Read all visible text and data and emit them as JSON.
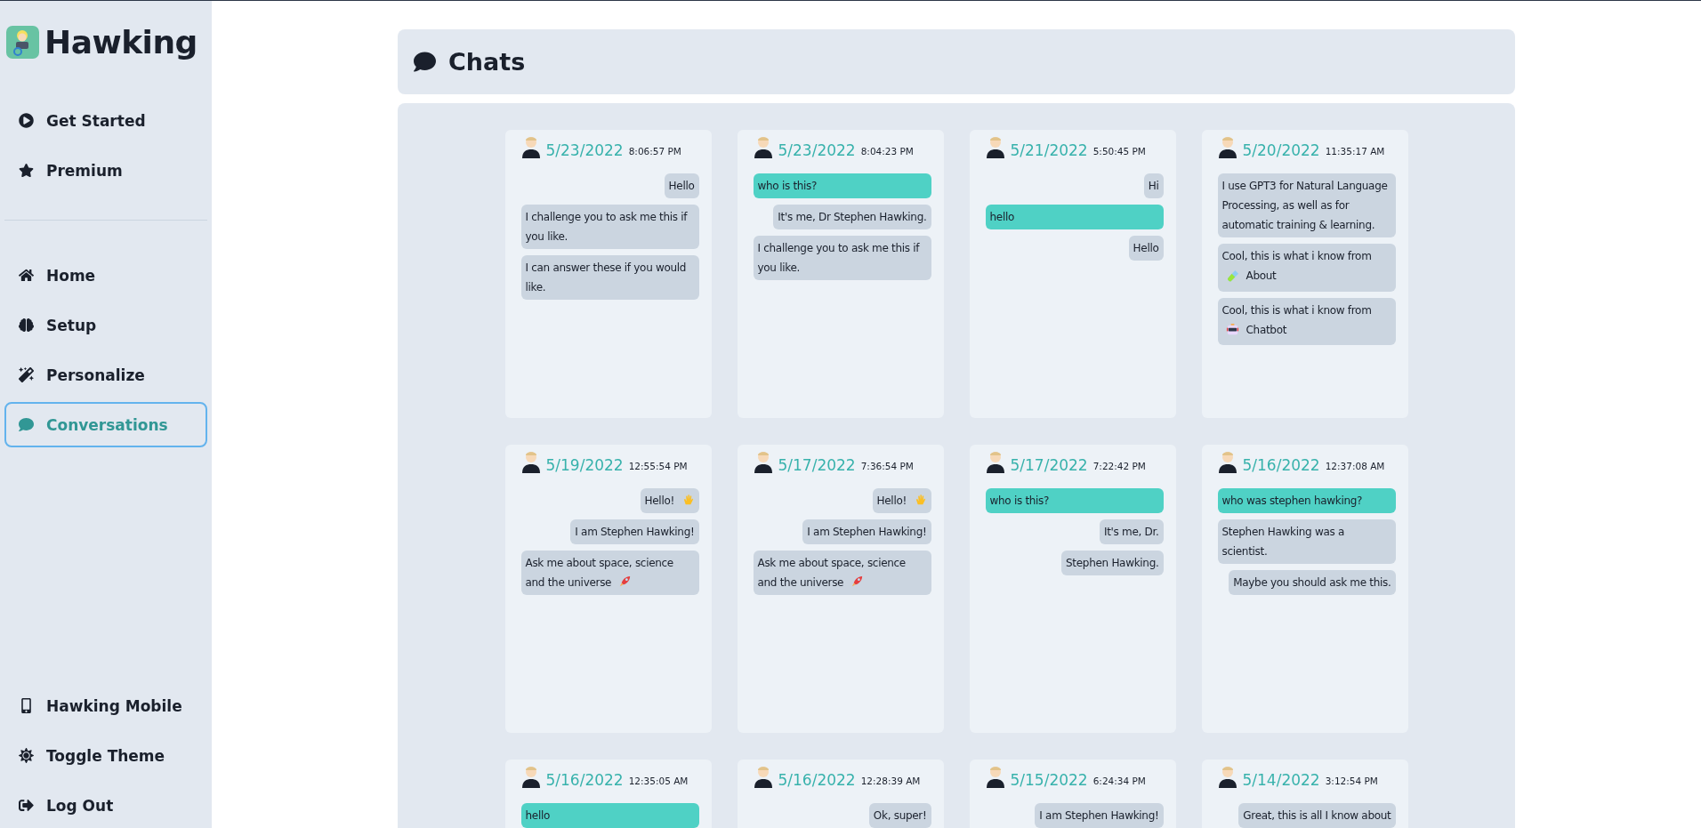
{
  "brand": {
    "name": "Hawking"
  },
  "sidebar": {
    "top_items": [
      {
        "label": "Get Started",
        "selected": false
      },
      {
        "label": "Premium",
        "selected": false
      }
    ],
    "items": [
      {
        "label": "Home",
        "selected": false
      },
      {
        "label": "Setup",
        "selected": false
      },
      {
        "label": "Personalize",
        "selected": false
      },
      {
        "label": "Conversations",
        "selected": true
      }
    ],
    "bottom_items": [
      {
        "label": "Hawking Mobile",
        "selected": false
      },
      {
        "label": "Toggle Theme",
        "selected": false
      },
      {
        "label": "Log Out",
        "selected": false
      }
    ]
  },
  "header": {
    "title": "Chats"
  },
  "chats": [
    {
      "date": "5/23/2022",
      "time": "8:06:57 PM",
      "messages": [
        {
          "kind": "bot",
          "text": "Hello"
        },
        {
          "kind": "bot",
          "text": "I challenge you to ask me this if you like."
        },
        {
          "kind": "bot",
          "text": "I can answer these if you would like."
        }
      ]
    },
    {
      "date": "5/23/2022",
      "time": "8:04:23 PM",
      "messages": [
        {
          "kind": "user",
          "text": "who is this?"
        },
        {
          "kind": "bot",
          "text": "It's me, Dr Stephen Hawking."
        },
        {
          "kind": "bot",
          "text": "I challenge you to ask me this if you like."
        }
      ]
    },
    {
      "date": "5/21/2022",
      "time": "5:50:45 PM",
      "messages": [
        {
          "kind": "bot",
          "text": "Hi"
        },
        {
          "kind": "user",
          "text": "hello"
        },
        {
          "kind": "bot",
          "text": "Hello"
        }
      ]
    },
    {
      "date": "5/20/2022",
      "time": "11:35:17 AM",
      "messages": [
        {
          "kind": "bot",
          "text": "I use GPT3 for Natural Language Processing, as well as for automatic training & learning."
        },
        {
          "kind": "bot",
          "text": "Cool, this is what i know from",
          "emoji": {
            "kind": "test-tube"
          },
          "link": "About"
        },
        {
          "kind": "bot",
          "text": "Cool, this is what i know from",
          "emoji": {
            "kind": "robot"
          },
          "link": "Chatbot"
        }
      ]
    },
    {
      "date": "5/19/2022",
      "time": "12:55:54 PM",
      "messages": [
        {
          "kind": "bot",
          "text": "Hello!",
          "emoji": {
            "kind": "wave"
          }
        },
        {
          "kind": "bot",
          "text": "I am Stephen Hawking!"
        },
        {
          "kind": "bot",
          "text": "Ask me about space, science and the universe",
          "emoji": {
            "kind": "rocket"
          }
        }
      ]
    },
    {
      "date": "5/17/2022",
      "time": "7:36:54 PM",
      "messages": [
        {
          "kind": "bot",
          "text": "Hello!",
          "emoji": {
            "kind": "wave"
          }
        },
        {
          "kind": "bot",
          "text": "I am Stephen Hawking!"
        },
        {
          "kind": "bot",
          "text": "Ask me about space, science and the universe",
          "emoji": {
            "kind": "rocket"
          }
        }
      ]
    },
    {
      "date": "5/17/2022",
      "time": "7:22:42 PM",
      "messages": [
        {
          "kind": "user",
          "text": "who is this?"
        },
        {
          "kind": "bot",
          "text": "It's me, Dr."
        },
        {
          "kind": "bot",
          "text": "Stephen Hawking."
        }
      ]
    },
    {
      "date": "5/16/2022",
      "time": "12:37:08 AM",
      "messages": [
        {
          "kind": "user",
          "text": "who was stephen hawking?"
        },
        {
          "kind": "bot",
          "text": "Stephen Hawking was a scientist."
        },
        {
          "kind": "bot",
          "text": "Maybe you should ask me this."
        }
      ]
    },
    {
      "date": "5/16/2022",
      "time": "12:35:05 AM",
      "messages": [
        {
          "kind": "user",
          "text": "hello"
        }
      ]
    },
    {
      "date": "5/16/2022",
      "time": "12:28:39 AM",
      "messages": [
        {
          "kind": "bot",
          "text": "Ok, super!"
        }
      ]
    },
    {
      "date": "5/15/2022",
      "time": "6:24:34 PM",
      "messages": [
        {
          "kind": "bot",
          "text": "I am Stephen Hawking!"
        }
      ]
    },
    {
      "date": "5/14/2022",
      "time": "3:12:54 PM",
      "messages": [
        {
          "kind": "bot",
          "text": "Great, this is all I know about"
        }
      ]
    }
  ]
}
